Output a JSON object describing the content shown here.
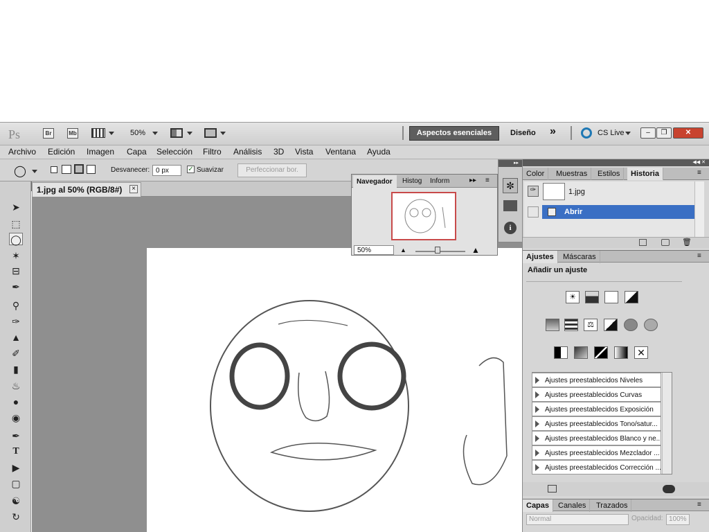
{
  "app": {
    "logo": "Ps",
    "bridge": "Br",
    "minibridge": "Mb",
    "zoom": "50%",
    "workspace_active": "Aspectos esenciales",
    "workspace_other": "Diseño",
    "more": "»",
    "cslive": "CS Live"
  },
  "menu": [
    "Archivo",
    "Edición",
    "Imagen",
    "Capa",
    "Selección",
    "Filtro",
    "Análisis",
    "3D",
    "Vista",
    "Ventana",
    "Ayuda"
  ],
  "options": {
    "feather_label": "Desvanecer:",
    "feather_value": "0 px",
    "antialias_label": "Suavizar",
    "refine_label": "Perfeccionar bor."
  },
  "document": {
    "tab_title": "1.jpg al 50% (RGB/8#)",
    "close": "×"
  },
  "navigator": {
    "tabs": [
      "Navegador",
      "Histog",
      "Inform"
    ],
    "zoom_value": "50%"
  },
  "history_panel": {
    "tabs": [
      "Color",
      "Muestras",
      "Estilos",
      "Historia"
    ],
    "snapshot_name": "1.jpg",
    "item": "Abrir"
  },
  "adjustments": {
    "tabs": [
      "Ajustes",
      "Máscaras"
    ],
    "heading": "Añadir un ajuste",
    "presets": [
      "Ajustes preestablecidos Niveles",
      "Ajustes preestablecidos Curvas",
      "Ajustes preestablecidos Exposición",
      "Ajustes preestablecidos Tono/satur...",
      "Ajustes preestablecidos Blanco y ne...",
      "Ajustes preestablecidos Mezclador ...",
      "Ajustes preestablecidos Corrección ..."
    ]
  },
  "layers": {
    "tabs": [
      "Capas",
      "Canales",
      "Trazados"
    ],
    "blend_mode": "Normal",
    "opacity_label": "Opacidad:",
    "opacity_value": "100%"
  },
  "colors": {
    "accent_selected": "#3a6fc4",
    "workspace_bg": "#5e5e5e",
    "close_red": "#c8432f"
  }
}
